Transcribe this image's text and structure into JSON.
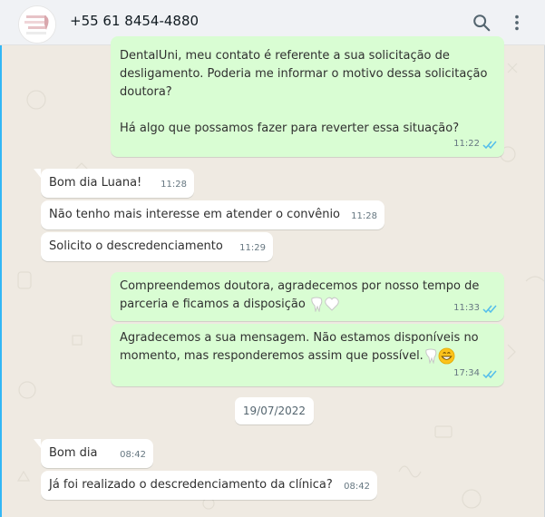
{
  "header": {
    "contact_name": "+55 61 8454-4880",
    "icons": [
      "search-icon",
      "menu-icon"
    ]
  },
  "messages": [
    {
      "direction": "out",
      "text": "DentalUni, meu contato é referente a sua solicitação de\ndesligamento. Poderia me informar o motivo dessa solicitação\ndoutora?\n\nHá algo que possamos fazer para reverter essa situação?",
      "time": "11:22",
      "read": true
    },
    {
      "direction": "in",
      "text": "Bom dia Luana!",
      "time": "11:28"
    },
    {
      "direction": "in",
      "text": "Não tenho mais interesse em atender o convênio",
      "time": "11:28"
    },
    {
      "direction": "in",
      "text": "Solicito o descredenciamento",
      "time": "11:29"
    },
    {
      "direction": "out",
      "text": "Compreendemos doutora, agradecemos por nosso tempo de\nparceria e ficamos a disposição ",
      "emojis": [
        "tooth-icon",
        "white-heart-icon"
      ],
      "time": "11:33",
      "read": true
    },
    {
      "direction": "out",
      "text": "Agradecemos a sua mensagem. Não estamos disponíveis no\nmomento, mas responderemos assim que possível.",
      "emojis": [
        "tooth-icon",
        "grinning-face-icon"
      ],
      "time": "17:34",
      "read": true
    },
    {
      "direction": "in",
      "text": "Bom dia",
      "time": "08:42"
    },
    {
      "direction": "in",
      "text": "Já foi realizado o descredenciamento da clínica?",
      "time": "08:42"
    }
  ],
  "date_separator": "19/07/2022",
  "colors": {
    "outgoing_bubble": "#d9fdd3",
    "incoming_bubble": "#ffffff",
    "read_ticks": "#53bdeb",
    "chat_background": "#efeae2"
  }
}
